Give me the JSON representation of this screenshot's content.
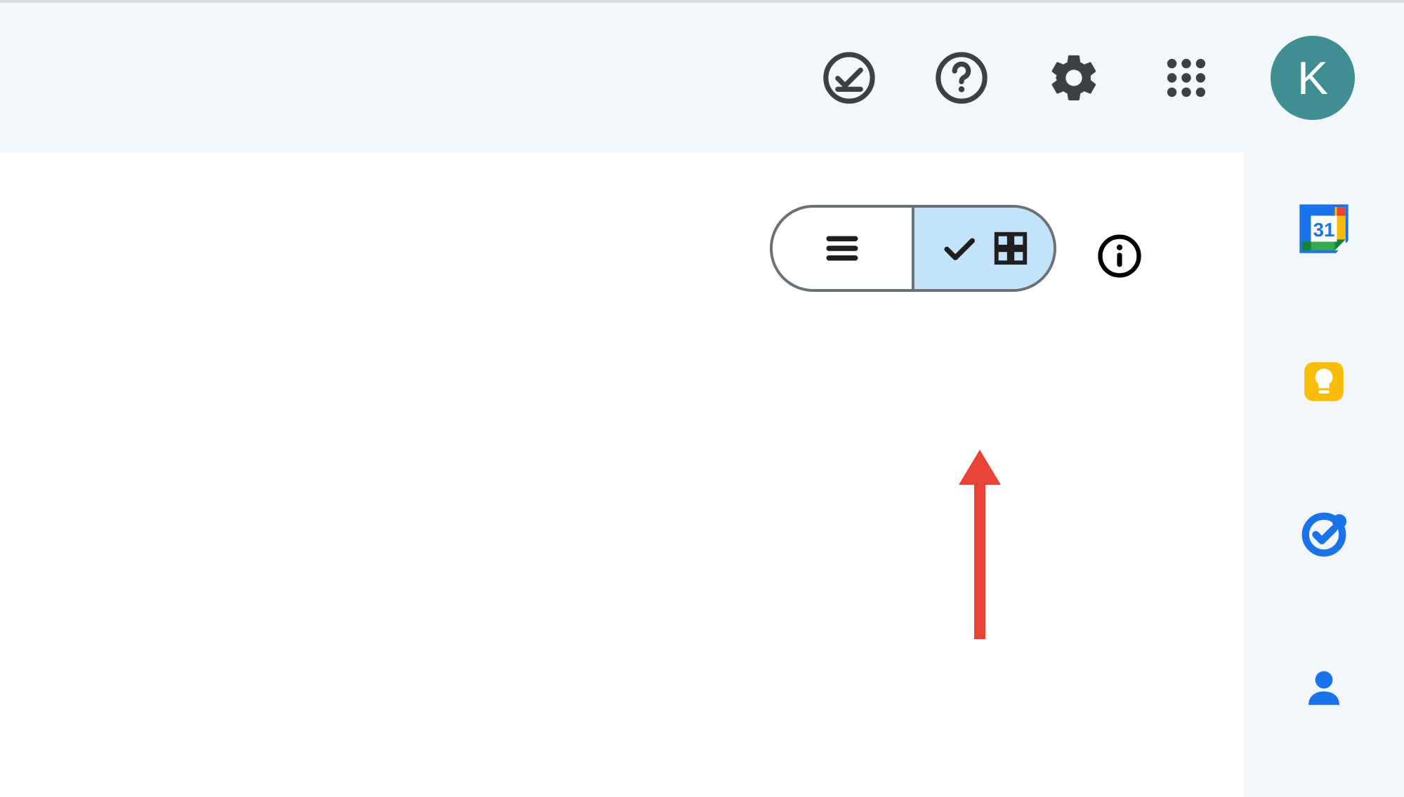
{
  "header": {
    "icons": {
      "offline": "offline-ready-icon",
      "help": "help-icon",
      "settings": "settings-icon",
      "apps": "apps-grid-icon"
    },
    "avatar_initial": "K",
    "avatar_color": "#3f8e91"
  },
  "view_toggle": {
    "list": {
      "icon": "list-icon",
      "selected": false
    },
    "grid": {
      "icon": "grid-icon",
      "selected": true,
      "check_icon": "check-icon"
    }
  },
  "info_icon": "info-icon",
  "side_panel": {
    "calendar": {
      "icon": "calendar-icon",
      "date_label": "31"
    },
    "keep": {
      "icon": "keep-icon"
    },
    "tasks": {
      "icon": "tasks-icon"
    },
    "contacts": {
      "icon": "contacts-icon"
    }
  },
  "annotation": {
    "arrow_color": "#ea4335"
  }
}
